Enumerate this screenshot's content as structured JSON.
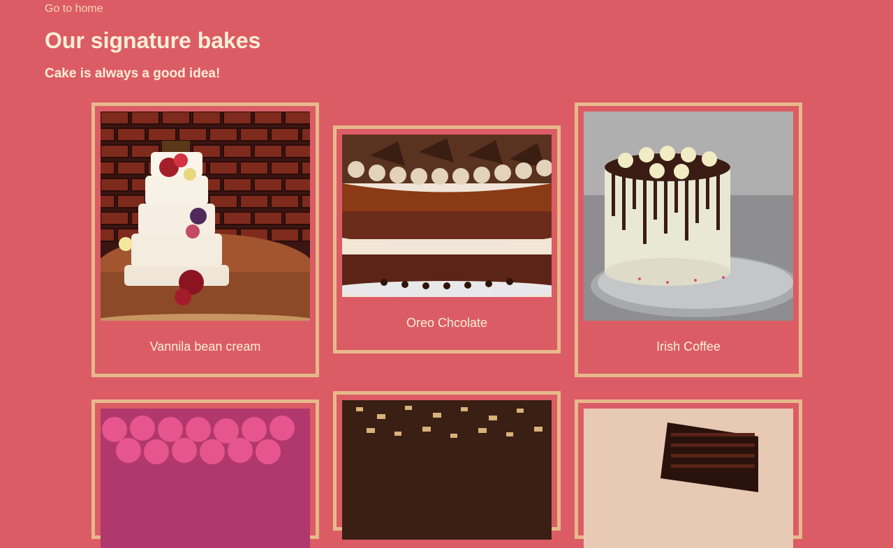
{
  "nav": {
    "home_link": "Go to home"
  },
  "header": {
    "title": "Our signature bakes",
    "subtitle": "Cake is always a good idea!"
  },
  "cakes": [
    {
      "name": "Vannila bean cream",
      "image": "tiered-white-cake-image"
    },
    {
      "name": "Oreo Chcolate",
      "image": "oreo-chocolate-cake-image"
    },
    {
      "name": "Irish Coffee",
      "image": "drip-cake-image"
    },
    {
      "name": "",
      "image": "pink-frosted-cake-image"
    },
    {
      "name": "",
      "image": "nut-chocolate-cake-image"
    },
    {
      "name": "",
      "image": "layered-chocolate-slice-image"
    }
  ],
  "colors": {
    "background": "#dc5c66",
    "card_border": "#e6b98a",
    "text": "#fbefd6"
  }
}
